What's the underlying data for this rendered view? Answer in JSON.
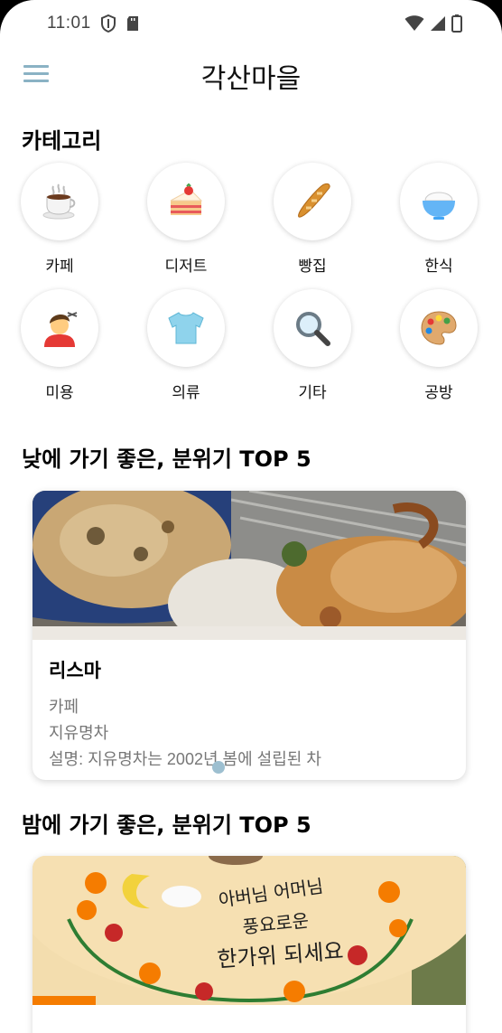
{
  "status_bar": {
    "time": "11:01",
    "icons": [
      "shield-icon",
      "sd-card-icon",
      "wifi-icon",
      "signal-icon",
      "battery-icon"
    ]
  },
  "app_bar": {
    "title": "각산마을",
    "menu_icon": "hamburger-menu-icon"
  },
  "categories": {
    "title": "카테고리",
    "items": [
      {
        "label": "카페",
        "icon": "coffee-cup-icon",
        "glyph": "☕"
      },
      {
        "label": "디저트",
        "icon": "cake-icon",
        "glyph": "🍰"
      },
      {
        "label": "빵집",
        "icon": "baguette-icon",
        "glyph": "🥖"
      },
      {
        "label": "한식",
        "icon": "rice-bowl-icon",
        "glyph": "🍚"
      },
      {
        "label": "미용",
        "icon": "haircut-icon",
        "glyph": "💇"
      },
      {
        "label": "의류",
        "icon": "tshirt-icon",
        "glyph": "👕"
      },
      {
        "label": "기타",
        "icon": "magnifier-icon",
        "glyph": "🔍"
      },
      {
        "label": "공방",
        "icon": "palette-icon",
        "glyph": "🎨"
      }
    ]
  },
  "day_section": {
    "title": "낮에 가기 좋은, 분위기 TOP 5",
    "card": {
      "name": "리스마",
      "category": "카페",
      "subtitle": "지유명차",
      "description": "설명: 지유명차는 2002년 봄에 설립된 차"
    }
  },
  "night_section": {
    "title": "밤에 가기 좋은, 분위기 TOP 5",
    "card": {
      "cake_text_line1": "아버님 어머님",
      "cake_text_line2": "풍요로운",
      "cake_text_line3": "한가위 되세요"
    }
  },
  "colors": {
    "accent": "#8ab2c4",
    "pager_dot": "#9dbfd0",
    "text_secondary": "#777777"
  }
}
